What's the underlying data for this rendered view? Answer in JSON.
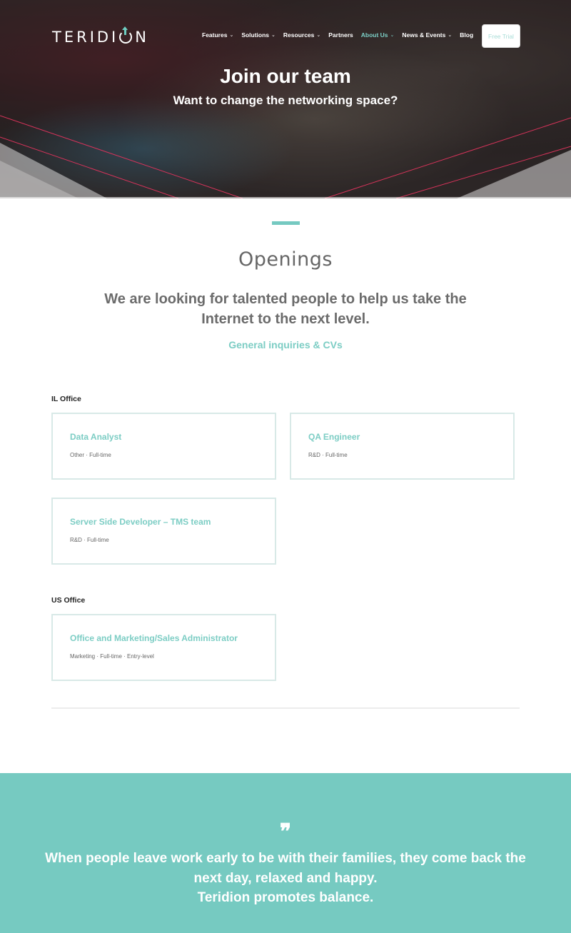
{
  "header": {
    "logo_text_left": "TERIDI",
    "logo_text_right": "N",
    "logo_alt": "TERIDION",
    "menu": [
      {
        "label": "Features",
        "dropdown": true,
        "active": false
      },
      {
        "label": "Solutions",
        "dropdown": true,
        "active": false
      },
      {
        "label": "Resources",
        "dropdown": true,
        "active": false
      },
      {
        "label": "Partners",
        "dropdown": false,
        "active": false
      },
      {
        "label": "About Us",
        "dropdown": true,
        "active": true
      },
      {
        "label": "News & Events",
        "dropdown": true,
        "active": false
      },
      {
        "label": "Blog",
        "dropdown": false,
        "active": false
      }
    ],
    "cta_label": "Free Trial",
    "chevron": "⌄"
  },
  "hero": {
    "title": "Join our team",
    "subtitle": "Want to change the networking space?"
  },
  "openings": {
    "title": "Openings",
    "lead": "We are looking for talented people to help us take the Internet to the next level.",
    "link_label": "General inquiries & CVs",
    "offices": [
      {
        "label": "IL Office",
        "jobs": [
          {
            "title": "Data Analyst",
            "meta": "Other · Full-time"
          },
          {
            "title": "QA Engineer",
            "meta": "R&D · Full-time"
          },
          {
            "title": "Server Side Developer – TMS team",
            "meta": "R&D · Full-time"
          }
        ]
      },
      {
        "label": "US Office",
        "jobs": [
          {
            "title": "Office and Marketing/Sales Administrator",
            "meta": "Marketing · Full-time · Entry-level"
          }
        ]
      }
    ]
  },
  "quote": {
    "mark": "❞",
    "text": "When people leave work early to be with their families, they come back the next day, relaxed and happy.",
    "tagline": "Teridion promotes balance."
  },
  "colors": {
    "accent": "#76cac1",
    "link": "#7ccdc4",
    "hero_line": "#d6335a"
  }
}
